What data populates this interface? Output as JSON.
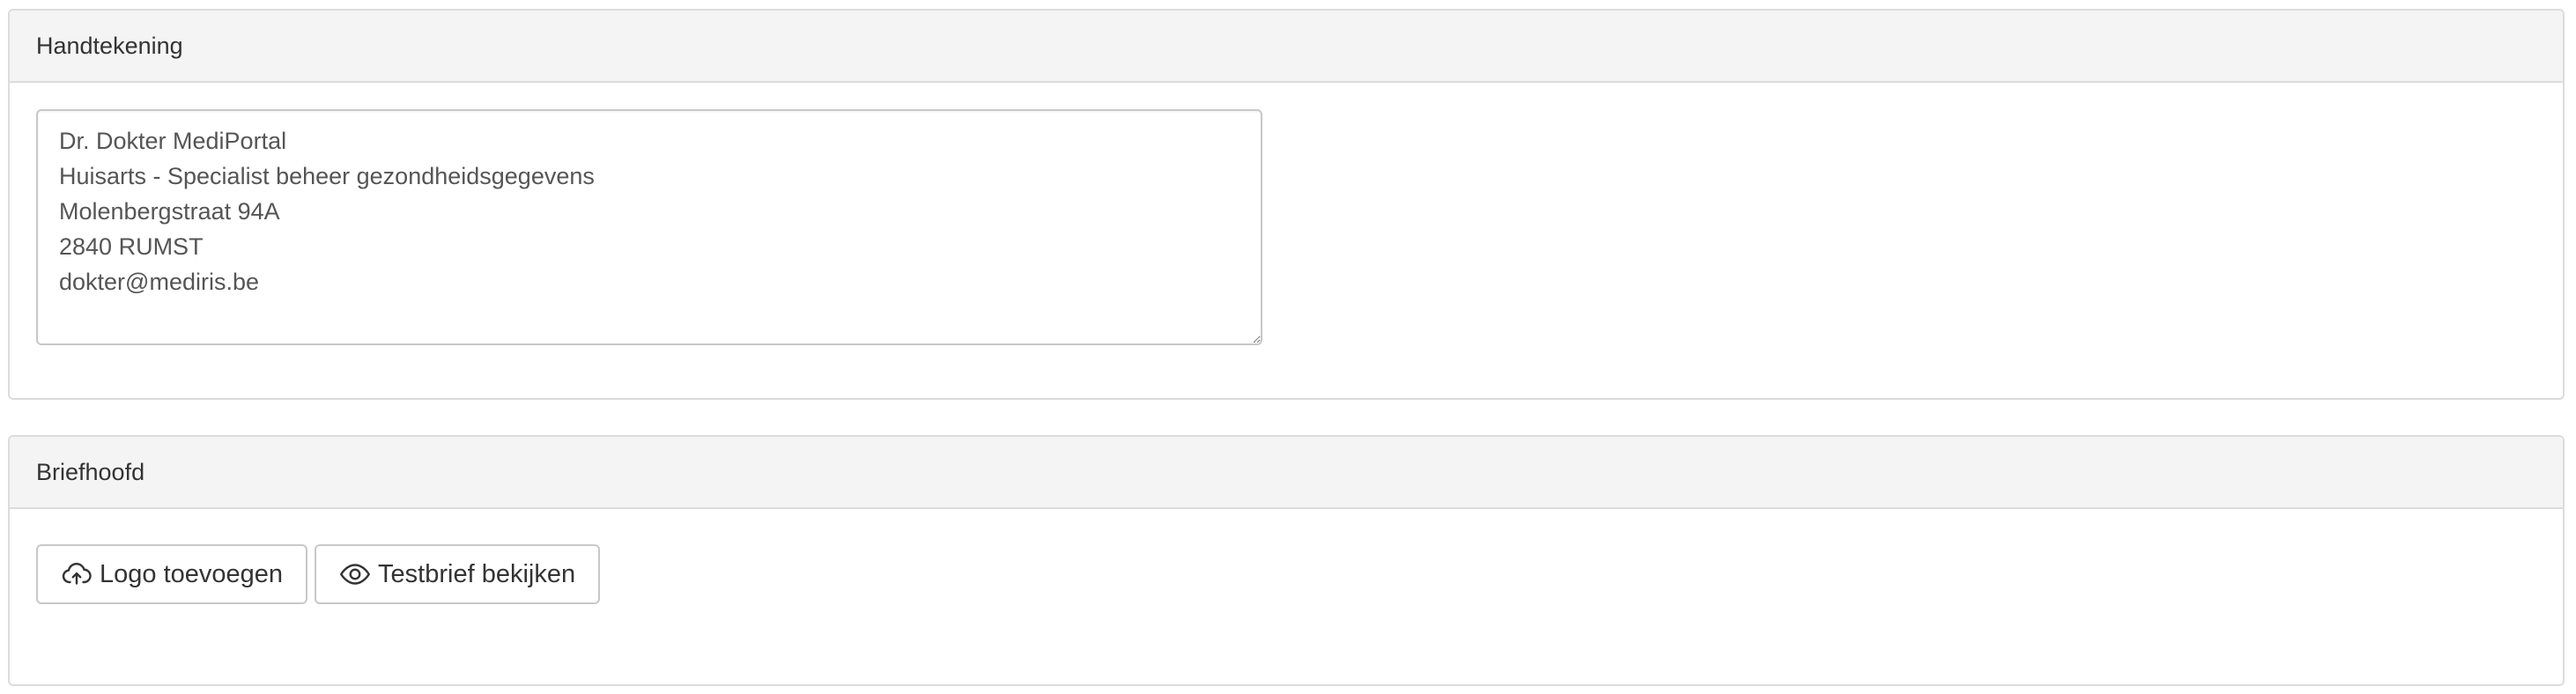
{
  "signature": {
    "heading": "Handtekening",
    "text": "Dr. Dokter MediPortal\nHuisarts - Specialist beheer gezondheidsgegevens\nMolenbergstraat 94A\n2840 RUMST\ndokter@mediris.be"
  },
  "letterhead": {
    "heading": "Briefhoofd",
    "buttons": {
      "add_logo": {
        "label": "Logo toevoegen",
        "icon": "cloud-upload-icon"
      },
      "view_test_letter": {
        "label": "Testbrief bekijken",
        "icon": "eye-icon"
      }
    }
  }
}
